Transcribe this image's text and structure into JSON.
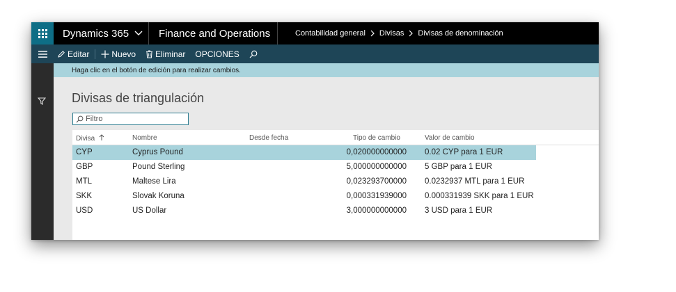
{
  "topbar": {
    "app_name": "Dynamics 365",
    "module": "Finance and Operations",
    "breadcrumbs": [
      "Contabilidad general",
      "Divisas",
      "Divisas de denominación"
    ]
  },
  "actionbar": {
    "edit": "Editar",
    "new": "Nuevo",
    "delete": "Eliminar",
    "options": "OPCIONES"
  },
  "infobar": {
    "message": "Haga clic en el botón de edición para realizar cambios."
  },
  "page": {
    "title": "Divisas de triangulación",
    "filter_placeholder": "Filtro"
  },
  "grid": {
    "columns": {
      "currency": "Divisa",
      "name": "Nombre",
      "from_date": "Desde fecha",
      "rate_type": "Tipo de cambio",
      "rate_value": "Valor de cambio"
    },
    "rows": [
      {
        "currency": "CYP",
        "name": "Cyprus Pound",
        "from_date": "",
        "rate_type": "0,020000000000",
        "rate_value": "0.02 CYP para 1 EUR"
      },
      {
        "currency": "GBP",
        "name": "Pound Sterling",
        "from_date": "",
        "rate_type": "5,000000000000",
        "rate_value": "5 GBP para 1 EUR"
      },
      {
        "currency": "MTL",
        "name": "Maltese Lira",
        "from_date": "",
        "rate_type": "0,023293700000",
        "rate_value": "0.0232937 MTL para 1 EUR"
      },
      {
        "currency": "SKK",
        "name": "Slovak Koruna",
        "from_date": "",
        "rate_type": "0,000331939000",
        "rate_value": "0.000331939 SKK para 1 EUR"
      },
      {
        "currency": "USD",
        "name": "US Dollar",
        "from_date": "",
        "rate_type": "3,000000000000",
        "rate_value": "3 USD para 1 EUR"
      }
    ]
  },
  "colors": {
    "accent": "#0e6e86",
    "actionbar": "#1e4557",
    "selection": "#a8d3dc"
  },
  "icons": [
    "waffle-icon",
    "chevron-down-icon",
    "chevron-right-icon",
    "hamburger-icon",
    "pencil-icon",
    "plus-icon",
    "trash-icon",
    "search-icon",
    "filter-icon",
    "sort-up-icon"
  ]
}
